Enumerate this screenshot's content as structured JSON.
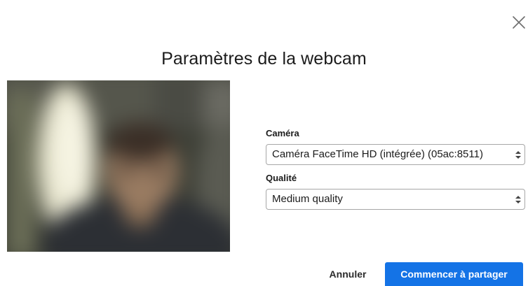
{
  "dialog": {
    "title": "Paramètres de la webcam",
    "close_icon": "close-icon"
  },
  "form": {
    "camera": {
      "label": "Caméra",
      "selected": "Caméra FaceTime HD (intégrée) (05ac:8511)",
      "icon": "select-arrows-icon"
    },
    "quality": {
      "label": "Qualité",
      "selected": "Medium quality",
      "icon": "select-arrows-icon"
    }
  },
  "actions": {
    "cancel_label": "Annuler",
    "share_label": "Commencer à partager"
  },
  "colors": {
    "primary": "#1473e6",
    "text": "#1b1b1b",
    "border": "#a7a7a7"
  }
}
